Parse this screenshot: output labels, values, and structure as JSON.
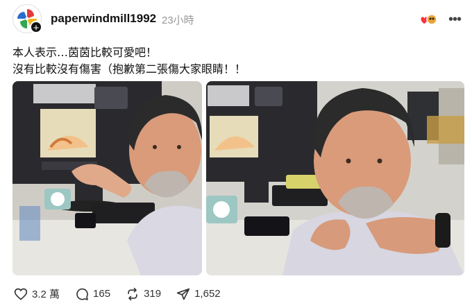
{
  "post": {
    "username": "paperwindmill1992",
    "timestamp": "23小時",
    "text_lines": [
      "本人表示…茵茵比較可愛吧！",
      "沒有比較沒有傷害（抱歉第二張傷大家眼睛！！"
    ]
  },
  "header": {
    "avatar_icon": "pinwheel-logo",
    "follow_icon": "plus-icon",
    "reaction_icons": [
      "heart-icon",
      "emoji-icon"
    ],
    "more_icon": "more-horizontal-icon"
  },
  "images": [
    {
      "label": "photo-1",
      "icon": "photo"
    },
    {
      "label": "photo-2",
      "icon": "photo"
    }
  ],
  "actions": {
    "likes": "3.2 萬",
    "comments": "165",
    "reposts": "319",
    "shares": "1,652"
  }
}
